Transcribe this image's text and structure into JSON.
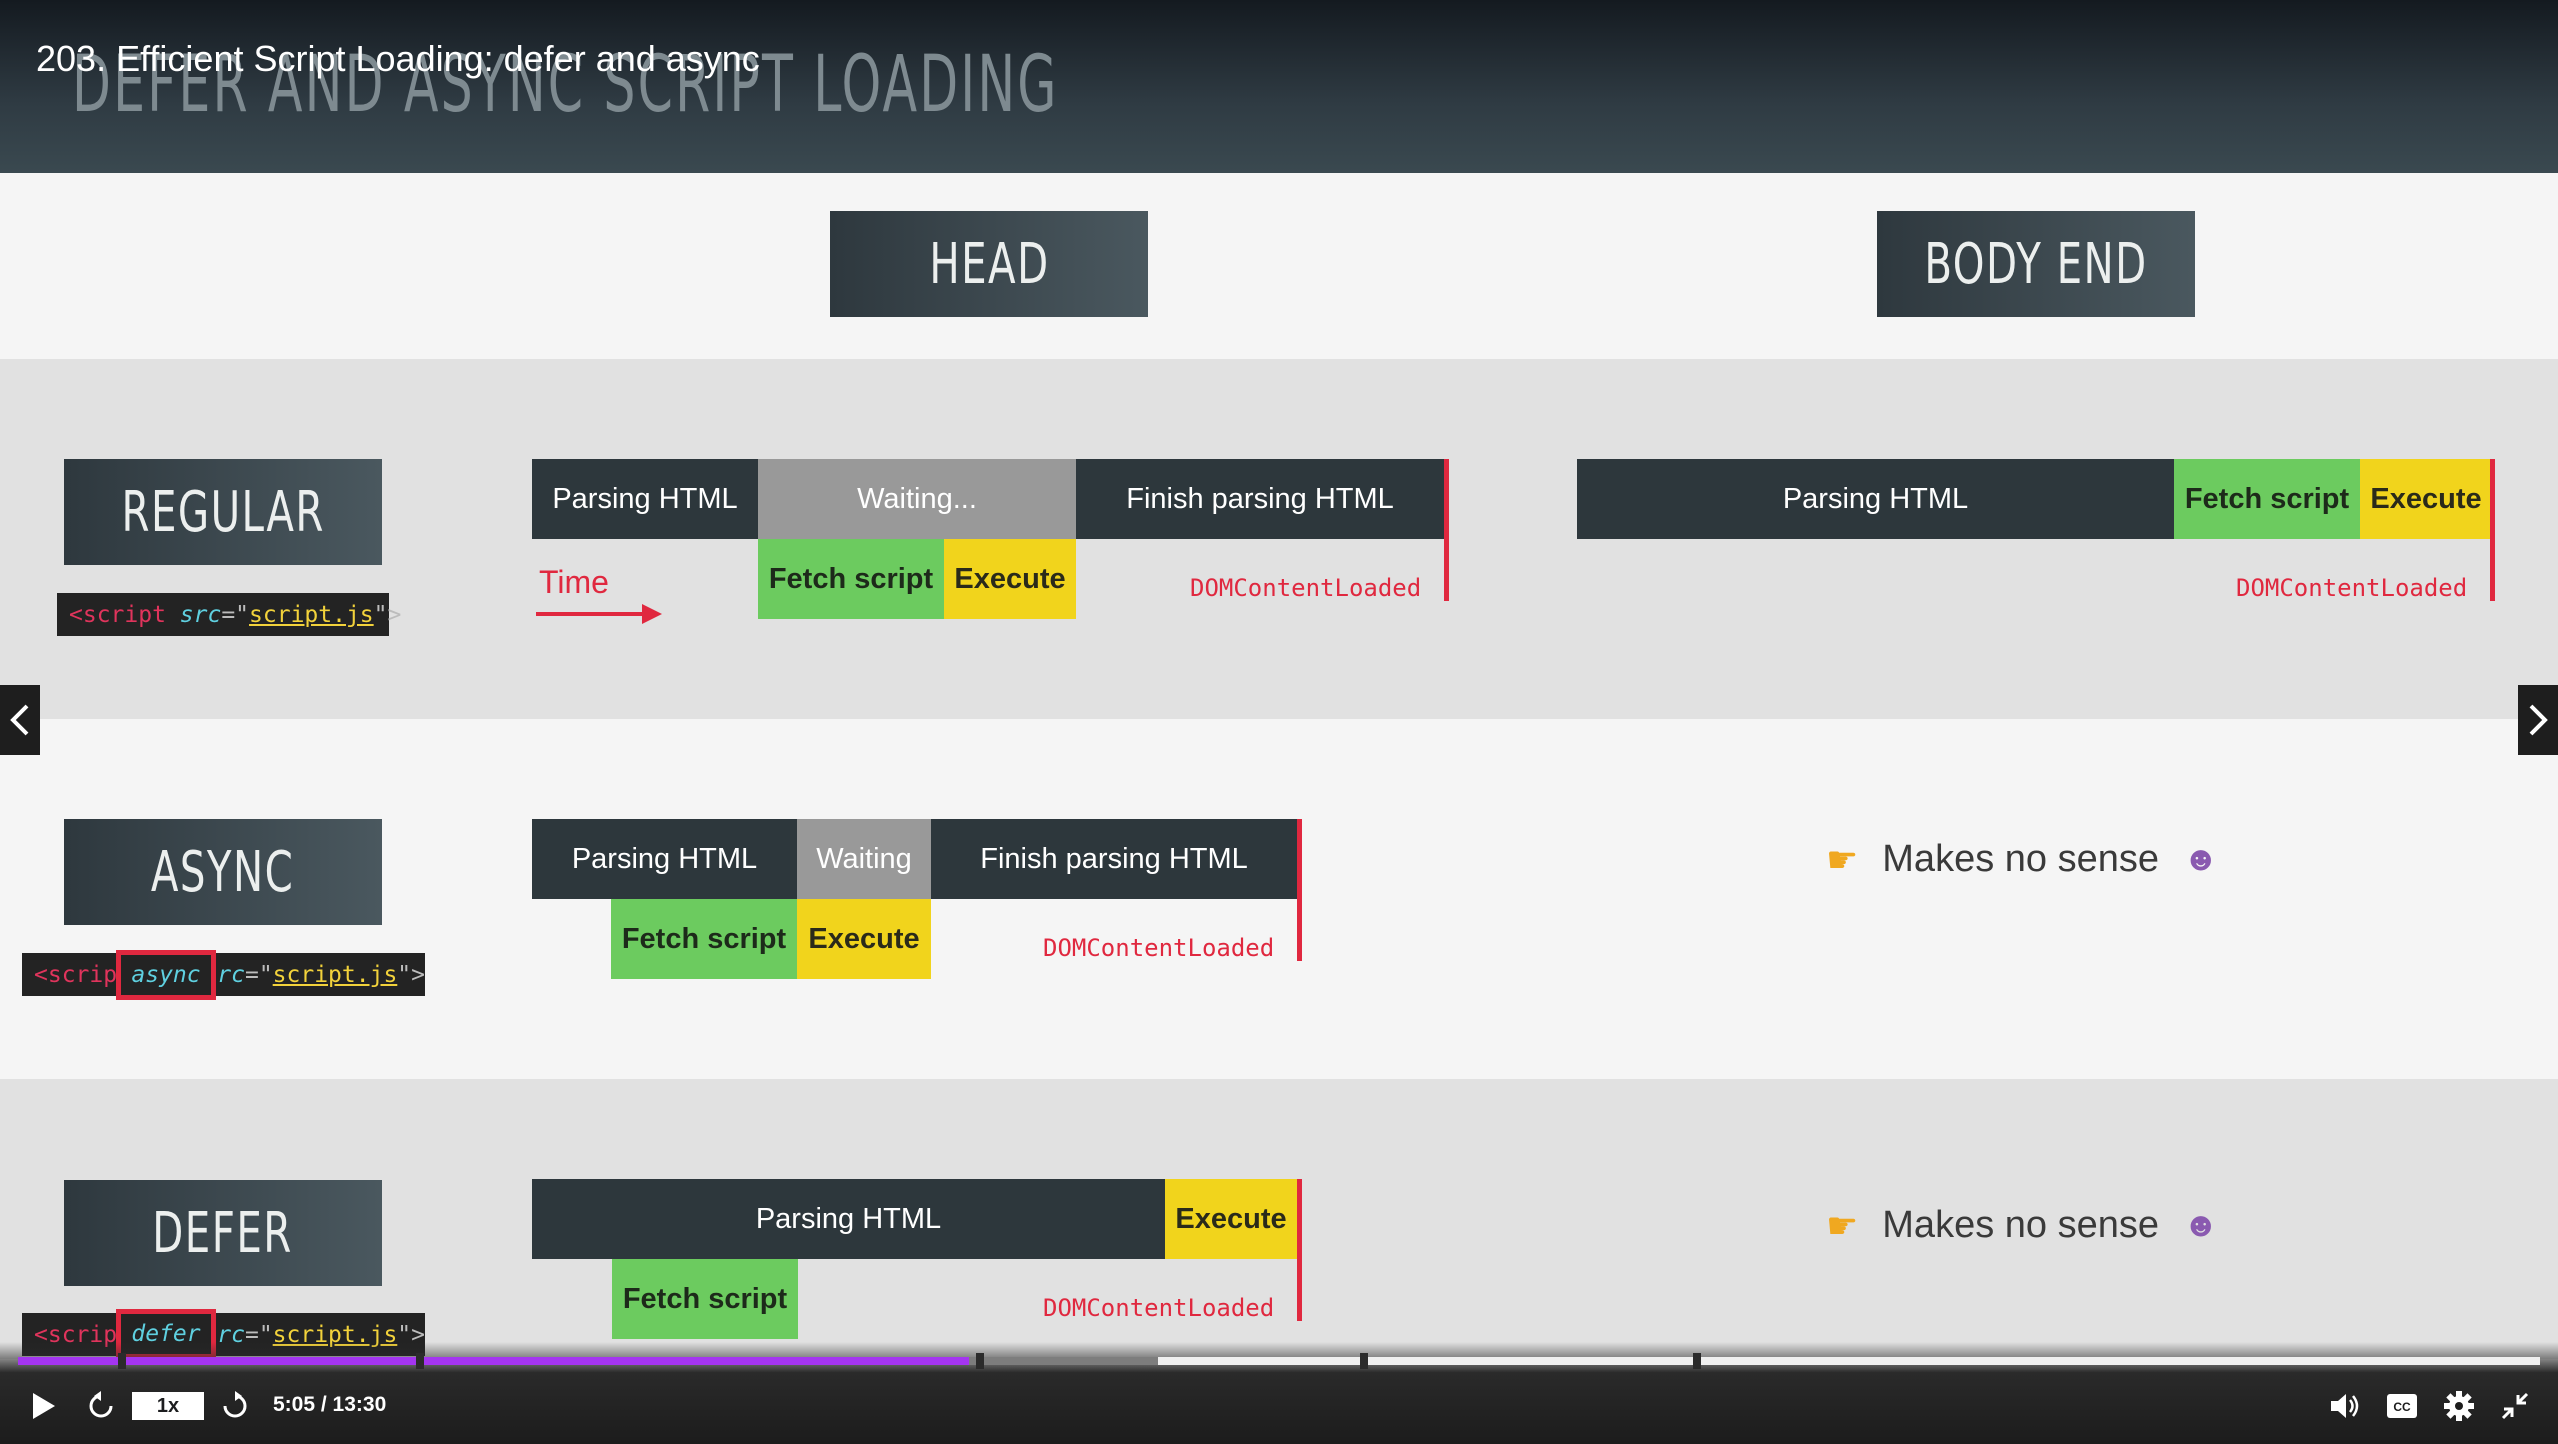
{
  "video": {
    "title": "203. Efficient Script Loading: defer and async",
    "slide_heading": "DEFER AND ASYNC SCRIPT LOADING"
  },
  "columns": {
    "head": "HEAD",
    "body_end": "BODY END"
  },
  "rows": {
    "regular": {
      "label": "REGULAR",
      "code": {
        "open": "<script ",
        "attr": "src",
        "eq": "=\"",
        "val": "script.js",
        "close": "\">"
      },
      "head": {
        "parsing": "Parsing HTML",
        "waiting": "Waiting...",
        "finish": "Finish parsing HTML",
        "fetch": "Fetch script",
        "execute": "Execute",
        "dcl": "DOMContentLoaded",
        "time": "Time"
      },
      "body": {
        "parsing": "Parsing HTML",
        "fetch": "Fetch script",
        "execute": "Execute",
        "dcl": "DOMContentLoaded"
      }
    },
    "async": {
      "label": "ASYNC",
      "code": {
        "open": "<scrip",
        "kw": "async",
        "rest_attr": "src",
        "eq": "=\"",
        "val": "script.js",
        "close": "\">"
      },
      "head": {
        "parsing": "Parsing HTML",
        "waiting": "Waiting",
        "finish": "Finish parsing HTML",
        "fetch": "Fetch script",
        "execute": "Execute",
        "dcl": "DOMContentLoaded"
      },
      "note": "Makes no sense"
    },
    "defer": {
      "label": "DEFER",
      "code": {
        "open": "<scrip",
        "kw": "defer",
        "rest_attr": "src",
        "eq": "=\"",
        "val": "script.js",
        "close": "\">"
      },
      "head": {
        "parsing": "Parsing HTML",
        "execute": "Execute",
        "fetch": "Fetch script",
        "dcl": "DOMContentLoaded"
      },
      "note": "Makes no sense"
    }
  },
  "player": {
    "speed": "1x",
    "time": "5:05 / 13:30",
    "progress_fraction": 0.377,
    "icons": [
      "play-icon",
      "rewind-icon",
      "forward-icon",
      "volume-icon",
      "captions-icon",
      "settings-icon",
      "fullscreen-exit-icon"
    ]
  },
  "colors": {
    "accent_progress": "#a435f0",
    "fetch_green": "#6ccb5f",
    "execute_yellow": "#f1d41c",
    "dcl_red": "#e0283f",
    "parsing_dark": "#2d373c",
    "waiting_gray": "#999999"
  }
}
